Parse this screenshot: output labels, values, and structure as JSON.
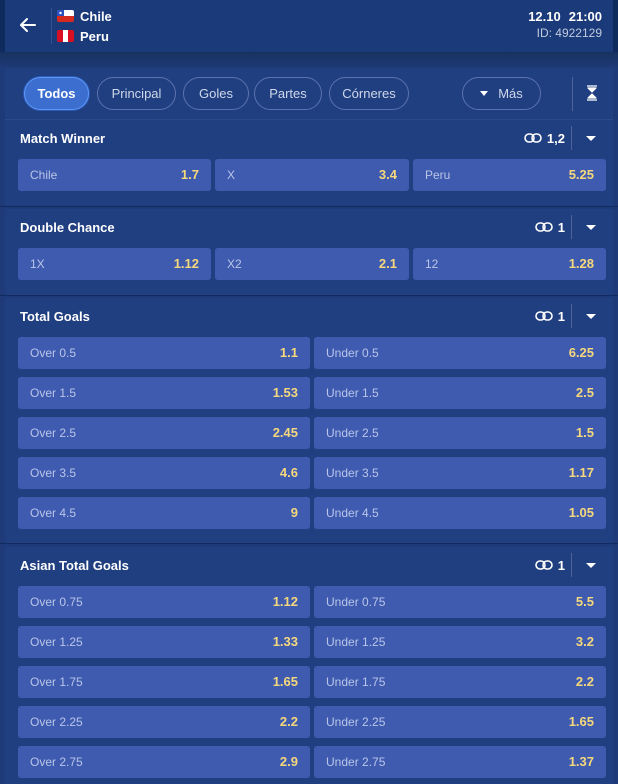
{
  "match": {
    "team1": "Chile",
    "team2": "Peru",
    "date": "12.10",
    "time": "21:00",
    "id": "ID: 4922129"
  },
  "filters": [
    "Todos",
    "Principal",
    "Goles",
    "Partes",
    "Córneres"
  ],
  "filters_more": "Más",
  "active_filter": "Todos",
  "colors": {
    "page_bg": "#1e3a78",
    "panel_bg": "#203f80",
    "odd_button": "#3f5bb0",
    "odd_value": "#f6d87c",
    "active_chip": "#3c6ed0"
  },
  "icons": [
    "back-arrow-icon",
    "chile-flag-icon",
    "peru-flag-icon",
    "caret-down-icon",
    "collapse-all-icon",
    "link-icon",
    "chevron-down-icon"
  ],
  "markets": [
    {
      "title": "Match Winner",
      "link_count": "1,2",
      "odds": [
        {
          "label": "Chile",
          "value": "1.7"
        },
        {
          "label": "X",
          "value": "3.4"
        },
        {
          "label": "Peru",
          "value": "5.25"
        }
      ]
    },
    {
      "title": "Double Chance",
      "link_count": "1",
      "odds": [
        {
          "label": "1X",
          "value": "1.12"
        },
        {
          "label": "X2",
          "value": "2.1"
        },
        {
          "label": "12",
          "value": "1.28"
        }
      ]
    },
    {
      "title": "Total Goals",
      "link_count": "1",
      "odds": [
        {
          "label": "Over 0.5",
          "value": "1.1"
        },
        {
          "label": "Under 0.5",
          "value": "6.25"
        },
        {
          "label": "Over 1.5",
          "value": "1.53"
        },
        {
          "label": "Under 1.5",
          "value": "2.5"
        },
        {
          "label": "Over 2.5",
          "value": "2.45"
        },
        {
          "label": "Under 2.5",
          "value": "1.5"
        },
        {
          "label": "Over 3.5",
          "value": "4.6"
        },
        {
          "label": "Under 3.5",
          "value": "1.17"
        },
        {
          "label": "Over 4.5",
          "value": "9"
        },
        {
          "label": "Under 4.5",
          "value": "1.05"
        }
      ]
    },
    {
      "title": "Asian Total Goals",
      "link_count": "1",
      "odds": [
        {
          "label": "Over 0.75",
          "value": "1.12"
        },
        {
          "label": "Under 0.75",
          "value": "5.5"
        },
        {
          "label": "Over 1.25",
          "value": "1.33"
        },
        {
          "label": "Under 1.25",
          "value": "3.2"
        },
        {
          "label": "Over 1.75",
          "value": "1.65"
        },
        {
          "label": "Under 1.75",
          "value": "2.2"
        },
        {
          "label": "Over 2.25",
          "value": "2.2"
        },
        {
          "label": "Under 2.25",
          "value": "1.65"
        },
        {
          "label": "Over 2.75",
          "value": "2.9"
        },
        {
          "label": "Under 2.75",
          "value": "1.37"
        }
      ]
    }
  ]
}
